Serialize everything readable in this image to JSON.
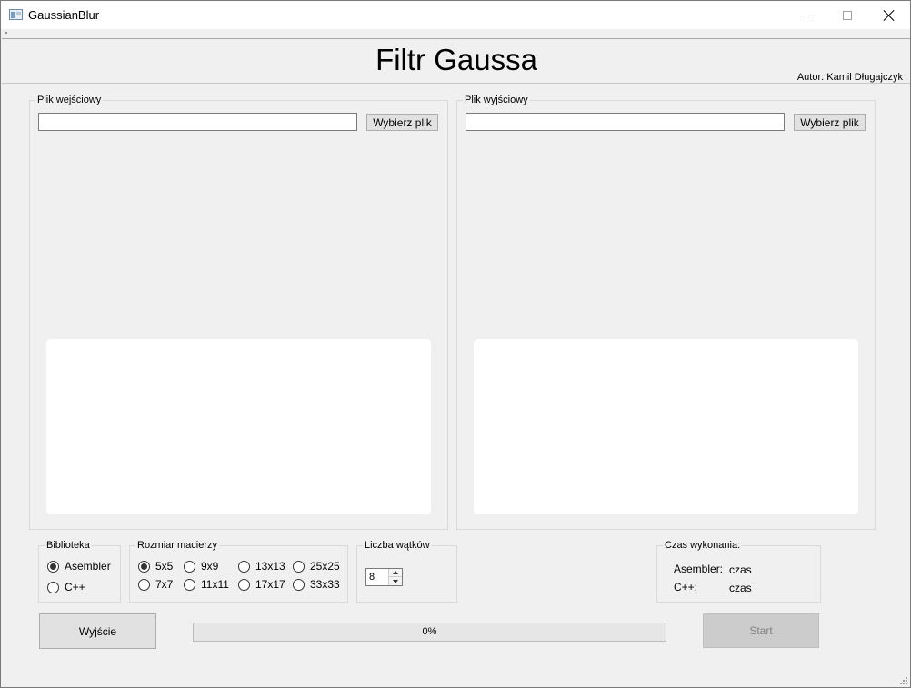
{
  "window": {
    "title": "GaussianBlur"
  },
  "header": {
    "title": "Filtr Gaussa",
    "author": "Autor: Kamil Długajczyk"
  },
  "input_panel": {
    "label": "Plik wejściowy",
    "path_value": "",
    "choose_button": "Wybierz plik"
  },
  "output_panel": {
    "label": "Plik wyjściowy",
    "path_value": "",
    "choose_button": "Wybierz plik"
  },
  "library": {
    "label": "Biblioteka",
    "options": [
      {
        "label": "Asembler",
        "checked": true
      },
      {
        "label": "C++",
        "checked": false
      }
    ]
  },
  "matrix": {
    "label": "Rozmiar macierzy",
    "options": [
      {
        "label": "5x5",
        "checked": true
      },
      {
        "label": "9x9",
        "checked": false
      },
      {
        "label": "13x13",
        "checked": false
      },
      {
        "label": "25x25",
        "checked": false
      },
      {
        "label": "7x7",
        "checked": false
      },
      {
        "label": "11x11",
        "checked": false
      },
      {
        "label": "17x17",
        "checked": false
      },
      {
        "label": "33x33",
        "checked": false
      }
    ]
  },
  "threads": {
    "label": "Liczba wątków",
    "value": "8"
  },
  "timing": {
    "label": "Czas wykonania:",
    "rows": [
      {
        "name": "Asembler:",
        "value": "czas"
      },
      {
        "name": "C++:",
        "value": "czas"
      }
    ]
  },
  "actions": {
    "exit_label": "Wyjście",
    "start_label": "Start"
  },
  "progress": {
    "value": 0,
    "text": "0%"
  },
  "colors": {
    "window_bg": "#f0f0f0",
    "progress_fill": "#06b025"
  }
}
